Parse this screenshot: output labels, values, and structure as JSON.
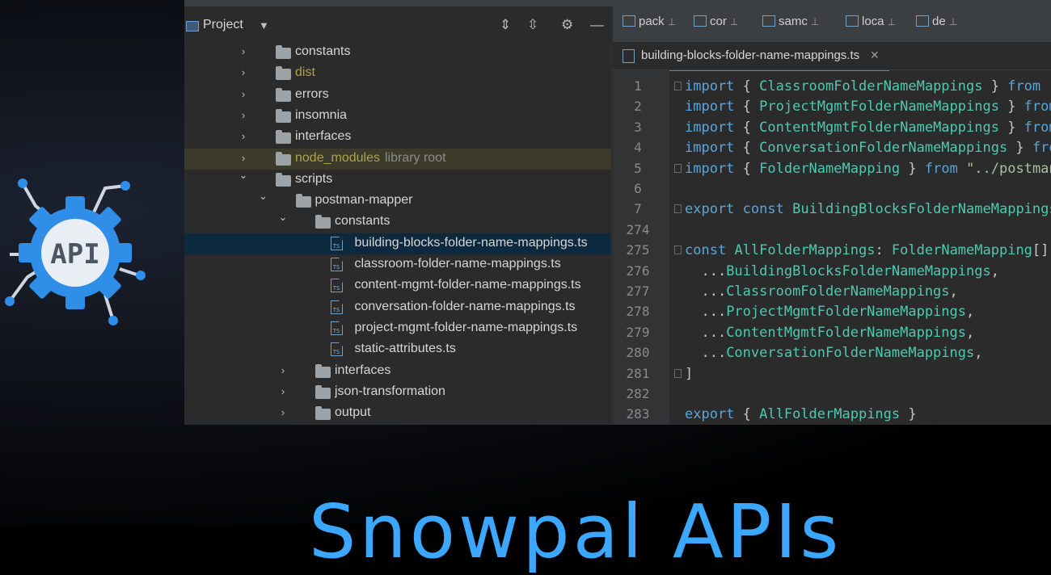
{
  "colors": {
    "accent": "#3ba7ff",
    "selection": "#0d293e"
  },
  "logo": {
    "text": "API"
  },
  "project_panel": {
    "title": "Project",
    "tree": [
      {
        "label": "constants",
        "kind": "folder",
        "expanded": false
      },
      {
        "label": "dist",
        "kind": "folder",
        "expanded": false,
        "color": "yellow"
      },
      {
        "label": "errors",
        "kind": "folder",
        "expanded": false
      },
      {
        "label": "insomnia",
        "kind": "folder",
        "expanded": false
      },
      {
        "label": "interfaces",
        "kind": "folder",
        "expanded": false
      },
      {
        "label": "node_modules",
        "suffix": "library root",
        "kind": "folder",
        "expanded": false,
        "color": "yellow"
      },
      {
        "label": "scripts",
        "kind": "folder",
        "expanded": true
      },
      {
        "label": "postman-mapper",
        "kind": "folder",
        "expanded": true
      },
      {
        "label": "constants",
        "kind": "folder",
        "expanded": true
      },
      {
        "label": "building-blocks-folder-name-mappings.ts",
        "kind": "ts",
        "selected": true
      },
      {
        "label": "classroom-folder-name-mappings.ts",
        "kind": "ts"
      },
      {
        "label": "content-mgmt-folder-name-mappings.ts",
        "kind": "ts"
      },
      {
        "label": "conversation-folder-name-mappings.ts",
        "kind": "ts"
      },
      {
        "label": "project-mgmt-folder-name-mappings.ts",
        "kind": "ts"
      },
      {
        "label": "static-attributes.ts",
        "kind": "ts"
      },
      {
        "label": "interfaces",
        "kind": "folder",
        "expanded": false
      },
      {
        "label": "json-transformation",
        "kind": "folder",
        "expanded": false
      },
      {
        "label": "output",
        "kind": "folder",
        "expanded": false
      }
    ]
  },
  "editor": {
    "tabs": [
      {
        "label": "pack"
      },
      {
        "label": "cor"
      },
      {
        "label": "samc"
      },
      {
        "label": "loca"
      },
      {
        "label": "de"
      }
    ],
    "active_file": "building-blocks-folder-name-mappings.ts",
    "lines": [
      {
        "n": "1",
        "code": "import { ClassroomFolderNameMappings } from \"./"
      },
      {
        "n": "2",
        "code": "import { ProjectMgmtFolderNameMappings } from \""
      },
      {
        "n": "3",
        "code": "import { ContentMgmtFolderNameMappings } from \""
      },
      {
        "n": "4",
        "code": "import { ConversationFolderNameMappings } from"
      },
      {
        "n": "5",
        "code": "import { FolderNameMapping } from \"../postman-m"
      },
      {
        "n": "6",
        "code": ""
      },
      {
        "n": "7",
        "code": "export const BuildingBlocksFolderNameMappings:"
      },
      {
        "n": "274",
        "code": ""
      },
      {
        "n": "275",
        "code": "const AllFolderMappings: FolderNameMapping[] ="
      },
      {
        "n": "276",
        "code": "  ...BuildingBlocksFolderNameMappings,"
      },
      {
        "n": "277",
        "code": "  ...ClassroomFolderNameMappings,"
      },
      {
        "n": "278",
        "code": "  ...ProjectMgmtFolderNameMappings,"
      },
      {
        "n": "279",
        "code": "  ...ContentMgmtFolderNameMappings,"
      },
      {
        "n": "280",
        "code": "  ...ConversationFolderNameMappings,"
      },
      {
        "n": "281",
        "code": "]"
      },
      {
        "n": "282",
        "code": ""
      },
      {
        "n": "283",
        "code": "export { AllFolderMappings }"
      }
    ]
  },
  "footer": {
    "title": "Snowpal APIs"
  }
}
